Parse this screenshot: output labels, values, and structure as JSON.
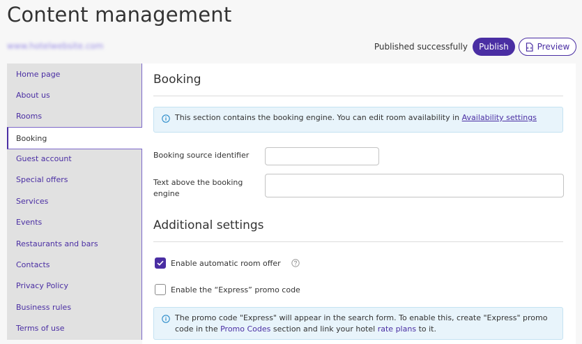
{
  "header": {
    "title": "Content management",
    "site_link": "www.hotelwebsite.com",
    "status": "Published successfully",
    "publish_label": "Publish",
    "preview_label": "Preview"
  },
  "sidebar": {
    "items": [
      {
        "label": "Home page"
      },
      {
        "label": "About us"
      },
      {
        "label": "Rooms"
      },
      {
        "label": "Booking"
      },
      {
        "label": "Guest account"
      },
      {
        "label": "Special offers"
      },
      {
        "label": "Services"
      },
      {
        "label": "Events"
      },
      {
        "label": "Restaurants and bars"
      },
      {
        "label": "Contacts"
      },
      {
        "label": "Privacy Policy"
      },
      {
        "label": "Business rules"
      },
      {
        "label": "Terms of use"
      }
    ],
    "active": "Booking"
  },
  "main": {
    "title": "Booking",
    "info": {
      "text": "This section contains the booking engine. You can edit room availability in",
      "link": "Availability settings"
    },
    "fields": {
      "source_label": "Booking source identifier",
      "source_value": "",
      "text_above_label": "Text above the booking engine",
      "text_above_value": ""
    },
    "additional": {
      "title": "Additional settings",
      "auto_offer_label": "Enable automatic room offer",
      "auto_offer_checked": true,
      "express_label": "Enable the “Express” promo code",
      "express_checked": false,
      "promo_info": {
        "part1": "The promo code \"Express\" will appear in the search form. To enable this, create \"Express\" promo code in the",
        "link1": "Promo Codes",
        "part2": "section and link your hotel",
        "link2": "rate plans",
        "part3": "to it."
      }
    }
  },
  "colors": {
    "accent": "#4a2ea3",
    "info_bg": "#e8f4fb",
    "sidebar_bg": "#e1e1e1"
  }
}
